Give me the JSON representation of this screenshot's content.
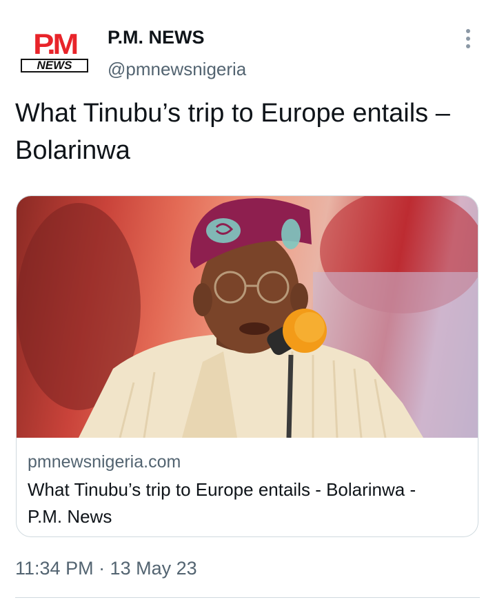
{
  "author": {
    "logo_text_top": "P.M",
    "logo_text_bottom": "NEWS",
    "display_name": "P.M. NEWS",
    "handle": "@pmnewsnigeria"
  },
  "tweet": {
    "text": "What Tinubu’s trip to Europe entails – Bolarinwa",
    "timestamp": "11:34 PM · 13 May 23"
  },
  "link_card": {
    "domain": "pmnewsnigeria.com",
    "title": "What Tinubu’s trip to Europe entails - Bolarinwa - P.M. News"
  },
  "icons": {
    "more": "more-options-icon"
  },
  "colors": {
    "logo_red": "#e8242a",
    "text_primary": "#0f1419",
    "text_secondary": "#536471",
    "border": "#cfd9de"
  }
}
